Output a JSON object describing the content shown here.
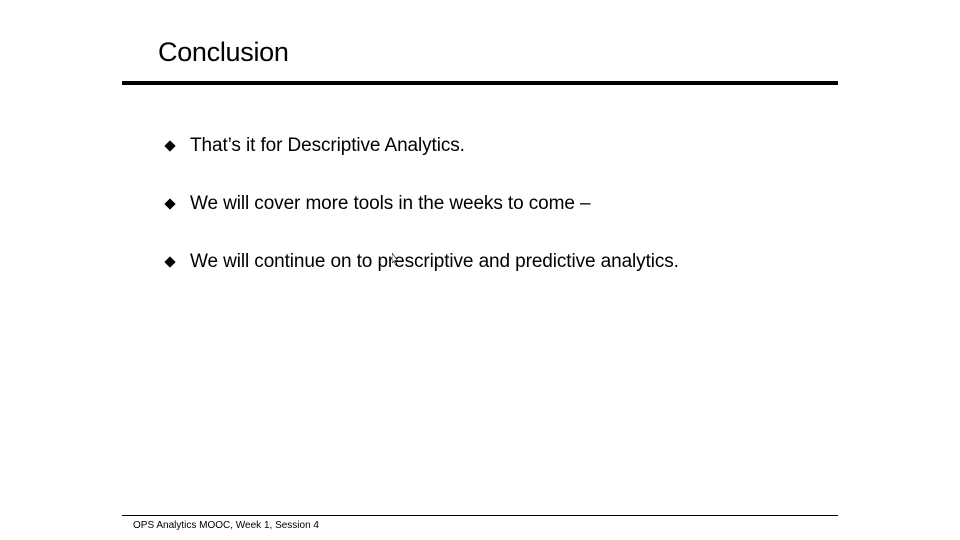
{
  "slide": {
    "title": "Conclusion",
    "bullets": [
      {
        "text": "That’s it for Descriptive Analytics."
      },
      {
        "text": "We will cover more tools in the weeks to come –"
      },
      {
        "text": "We will continue on to prescriptive and predictive analytics."
      }
    ],
    "footer": "OPS Analytics MOOC, Week 1, Session 4"
  },
  "icons": {
    "bullet": "diamond-bullet-icon",
    "cursor": "mouse-cursor-icon"
  },
  "colors": {
    "background": "#ffffff",
    "text": "#000000"
  }
}
